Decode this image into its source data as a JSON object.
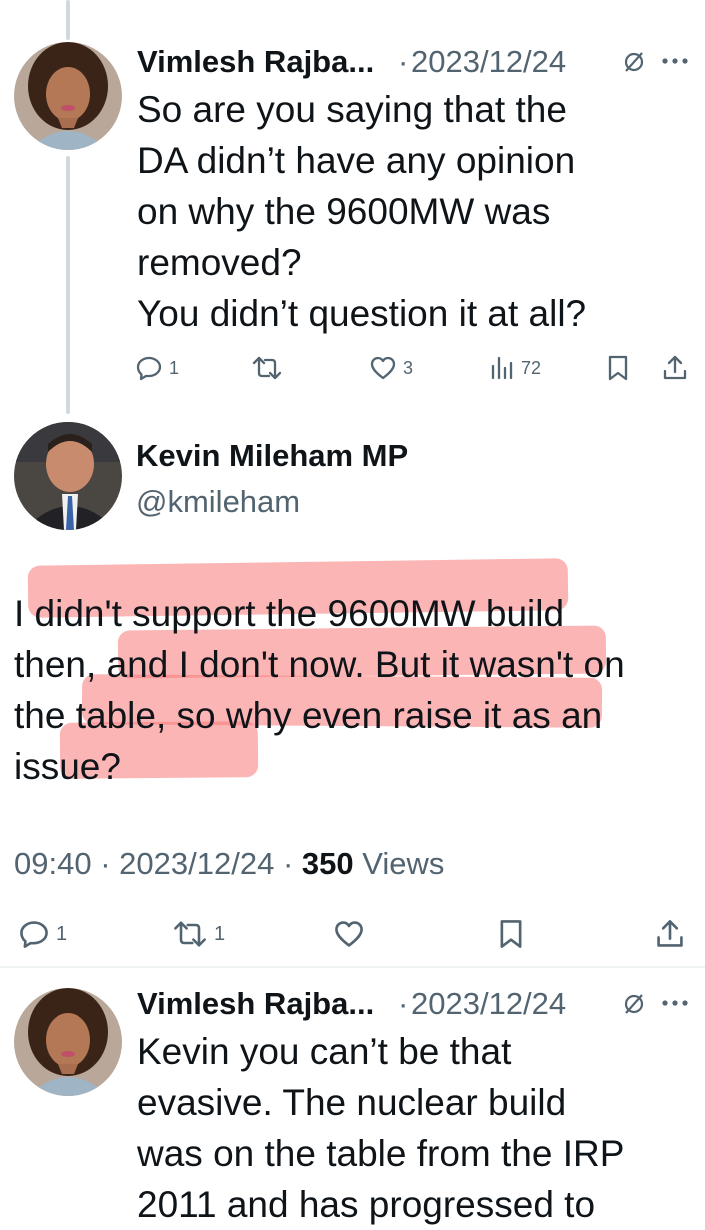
{
  "reply1": {
    "author": "Vimlesh Rajba...",
    "separator": "·",
    "date": "2023/12/24",
    "lines": [
      "So are you saying that the",
      "DA didn’t have any opinion",
      "on why the 9600MW was",
      "removed?",
      "You didn’t question it at all?"
    ],
    "replies": "1",
    "likes": "3",
    "views": "72"
  },
  "main": {
    "author": "Kevin Mileham MP",
    "handle": "@kmileham",
    "lines": [
      "I didn't support the 9600MW build",
      "then, and I don't now. But it wasn't on",
      "the table, so why even raise it as an",
      "issue?"
    ],
    "time": "09:40",
    "sep1": "·",
    "date": "2023/12/24",
    "sep2": "·",
    "views_count": "350",
    "views_label": "Views",
    "replies": "1",
    "retweets": "1",
    "highlight_color": "#fa7878"
  },
  "reply2": {
    "author": "Vimlesh Rajba...",
    "separator": "·",
    "date": "2023/12/24",
    "lines": [
      "Kevin you can’t be that",
      "evasive. The nuclear build",
      "was on the table from the IRP",
      "2011 and has progressed to"
    ]
  },
  "icons": {
    "reply": "speech-bubble-icon",
    "retweet": "retweet-arrows-icon",
    "like": "heart-icon",
    "views": "bar-chart-icon",
    "bookmark": "bookmark-icon",
    "share": "share-icon",
    "grok": "slashed-circle-icon",
    "more": "ellipsis-icon"
  }
}
